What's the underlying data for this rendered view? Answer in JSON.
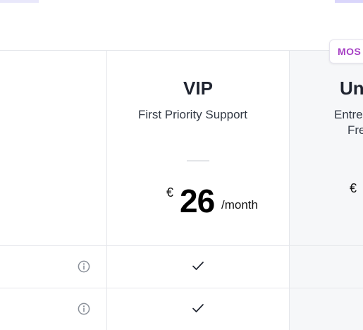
{
  "colors": {
    "border": "#e5e7eb",
    "highlight_column": "#f6f7f9",
    "badge_text": "#a63fc4",
    "tab_left": "#e9e8fb",
    "tab_right": "#dad6fb"
  },
  "badge": {
    "label": "MOS"
  },
  "plans": [
    {
      "name": "VIP",
      "description_lines": [
        "First Priority Support"
      ],
      "currency": "€",
      "price": "26",
      "period": "/month"
    },
    {
      "name": "Un",
      "description_lines": [
        "Entre",
        "Fre"
      ],
      "currency": "€",
      "price": "",
      "period": ""
    }
  ],
  "features": [
    {
      "icon": "info-icon",
      "vip": "check-icon"
    },
    {
      "icon": "info-icon",
      "vip": "check-icon"
    }
  ]
}
